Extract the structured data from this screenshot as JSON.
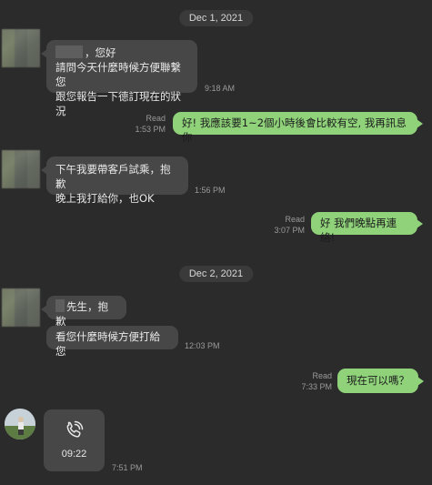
{
  "dates": [
    "Dec 1, 2021",
    "Dec 2, 2021"
  ],
  "messages": [
    {
      "dir": "in",
      "lines": [
        "，您好",
        "請問今天什麼時候方便聯繫您",
        "跟您報告一下德訂現在的狀況"
      ],
      "time": "9:18 AM"
    },
    {
      "dir": "out",
      "text": "好! 我應該要1~2個小時後會比較有空, 我再訊息你",
      "read": "Read",
      "time": "1:53 PM"
    },
    {
      "dir": "in",
      "lines": [
        "下午我要帶客戶試乘，抱歉",
        "晚上我打給你，也OK"
      ],
      "time": "1:56 PM"
    },
    {
      "dir": "out",
      "text": "好 我們晚點再連絡!",
      "read": "Read",
      "time": "3:07 PM"
    },
    {
      "dir": "in",
      "text": "先生，抱歉"
    },
    {
      "dir": "in",
      "text": "看您什麼時候方便打給您",
      "time": "12:03 PM"
    },
    {
      "dir": "out",
      "text": "現在可以嗎？",
      "read": "Read",
      "time": "7:33 PM"
    }
  ],
  "call": {
    "icon": "phone-call-icon",
    "duration": "09:22",
    "time": "7:51 PM"
  },
  "colors": {
    "background": "#2b2b2b",
    "incoming": "#474747",
    "outgoing": "#8fd27a"
  }
}
